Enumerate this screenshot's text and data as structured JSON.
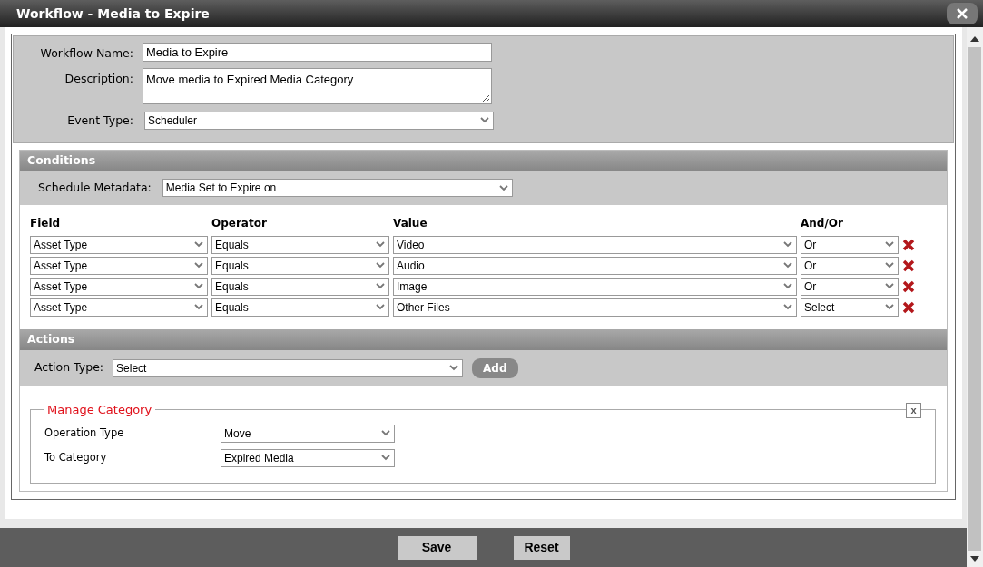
{
  "window": {
    "title": "Workflow - Media to Expire"
  },
  "general": {
    "fields": [
      {
        "kind": "text",
        "label": "Workflow Name:",
        "value": "Media to Expire"
      },
      {
        "kind": "textarea",
        "label": "Description:",
        "value": "Move media to Expired Media Category"
      },
      {
        "kind": "select",
        "label": "Event Type:",
        "value": "Scheduler"
      }
    ]
  },
  "conditions": {
    "title": "Conditions",
    "schedule_metadata": {
      "label": "Schedule Metadata:",
      "value": "Media Set to Expire on"
    },
    "columns": [
      "Field",
      "Operator",
      "Value",
      "And/Or"
    ],
    "rows": [
      {
        "field": "Asset Type",
        "operator": "Equals",
        "value": "Video",
        "and_or": "Or"
      },
      {
        "field": "Asset Type",
        "operator": "Equals",
        "value": "Audio",
        "and_or": "Or"
      },
      {
        "field": "Asset Type",
        "operator": "Equals",
        "value": "Image",
        "and_or": "Or"
      },
      {
        "field": "Asset Type",
        "operator": "Equals",
        "value": "Other Files",
        "and_or": "Select"
      }
    ]
  },
  "actions": {
    "title": "Actions",
    "action_type": {
      "label": "Action Type:",
      "value": "Select"
    },
    "add_button": "Add",
    "groups": [
      {
        "title": "Manage Category",
        "close": "x",
        "fields": [
          {
            "label": "Operation Type",
            "value": "Move"
          },
          {
            "label": "To Category",
            "value": "Expired Media"
          }
        ]
      }
    ]
  },
  "footer": {
    "buttons": [
      "Save",
      "Reset"
    ]
  }
}
